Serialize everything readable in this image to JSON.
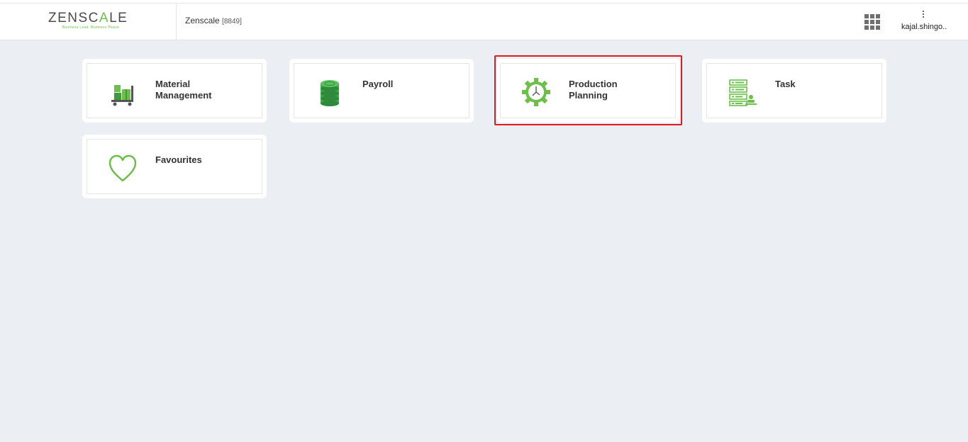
{
  "header": {
    "logo_prefix": "ZENSC",
    "logo_mid": "A",
    "logo_suffix": "LE",
    "logo_tagline": "Business Lead. Business Peace.",
    "company_name": "Zenscale",
    "company_code": "[8849]",
    "apps_icon": "grid-apps-icon",
    "menu_icon": "kebab-menu-icon",
    "username": "kajal.shingo.."
  },
  "modules": [
    {
      "label": "Material\nManagement",
      "icon": "trolley-boxes-icon"
    },
    {
      "label": "Payroll",
      "icon": "coin-stack-icon"
    },
    {
      "label": "Production\nPlanning",
      "icon": "gear-clock-icon"
    },
    {
      "label": "Task",
      "icon": "task-list-icon"
    },
    {
      "label": "Favourites",
      "icon": "heart-icon"
    }
  ],
  "colors": {
    "accent_green": "#6cc04a",
    "dark_green": "#2e8b3a",
    "highlight_red": "#e0191f",
    "background": "#ebeef3"
  }
}
